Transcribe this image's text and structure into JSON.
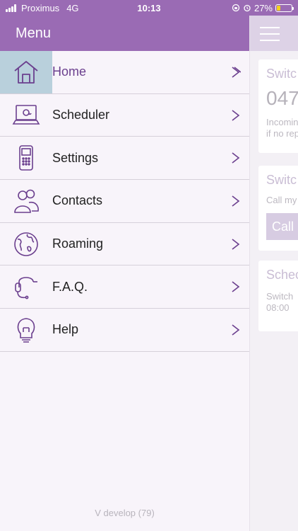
{
  "status_bar": {
    "carrier": "Proximus",
    "network": "4G",
    "time": "10:13",
    "battery_percent": "27%",
    "battery_level": 0.27
  },
  "menu": {
    "title": "Menu",
    "items": [
      {
        "label": "Home",
        "icon": "home-icon",
        "active": true
      },
      {
        "label": "Scheduler",
        "icon": "laptop-icon",
        "active": false
      },
      {
        "label": "Settings",
        "icon": "phone-icon",
        "active": false
      },
      {
        "label": "Contacts",
        "icon": "contacts-icon",
        "active": false
      },
      {
        "label": "Roaming",
        "icon": "globe-icon",
        "active": false
      },
      {
        "label": "F.A.Q.",
        "icon": "headset-icon",
        "active": false
      },
      {
        "label": "Help",
        "icon": "lightbulb-icon",
        "active": false
      }
    ],
    "version": "V develop (79)"
  },
  "content_peek": {
    "card1_title": "Switc",
    "card1_number": "047",
    "card1_line1": "Incomin",
    "card1_line2": "if no rep",
    "card2_title": "Switc",
    "card2_line1": "Call my",
    "card2_button": "Call",
    "card3_title": "Schec",
    "card3_line1": "Switch",
    "card3_line2": "08:00"
  },
  "colors": {
    "brand_purple": "#9a6bb4",
    "active_highlight": "#b9d0dc",
    "icon_stroke": "#6b3f8e"
  }
}
